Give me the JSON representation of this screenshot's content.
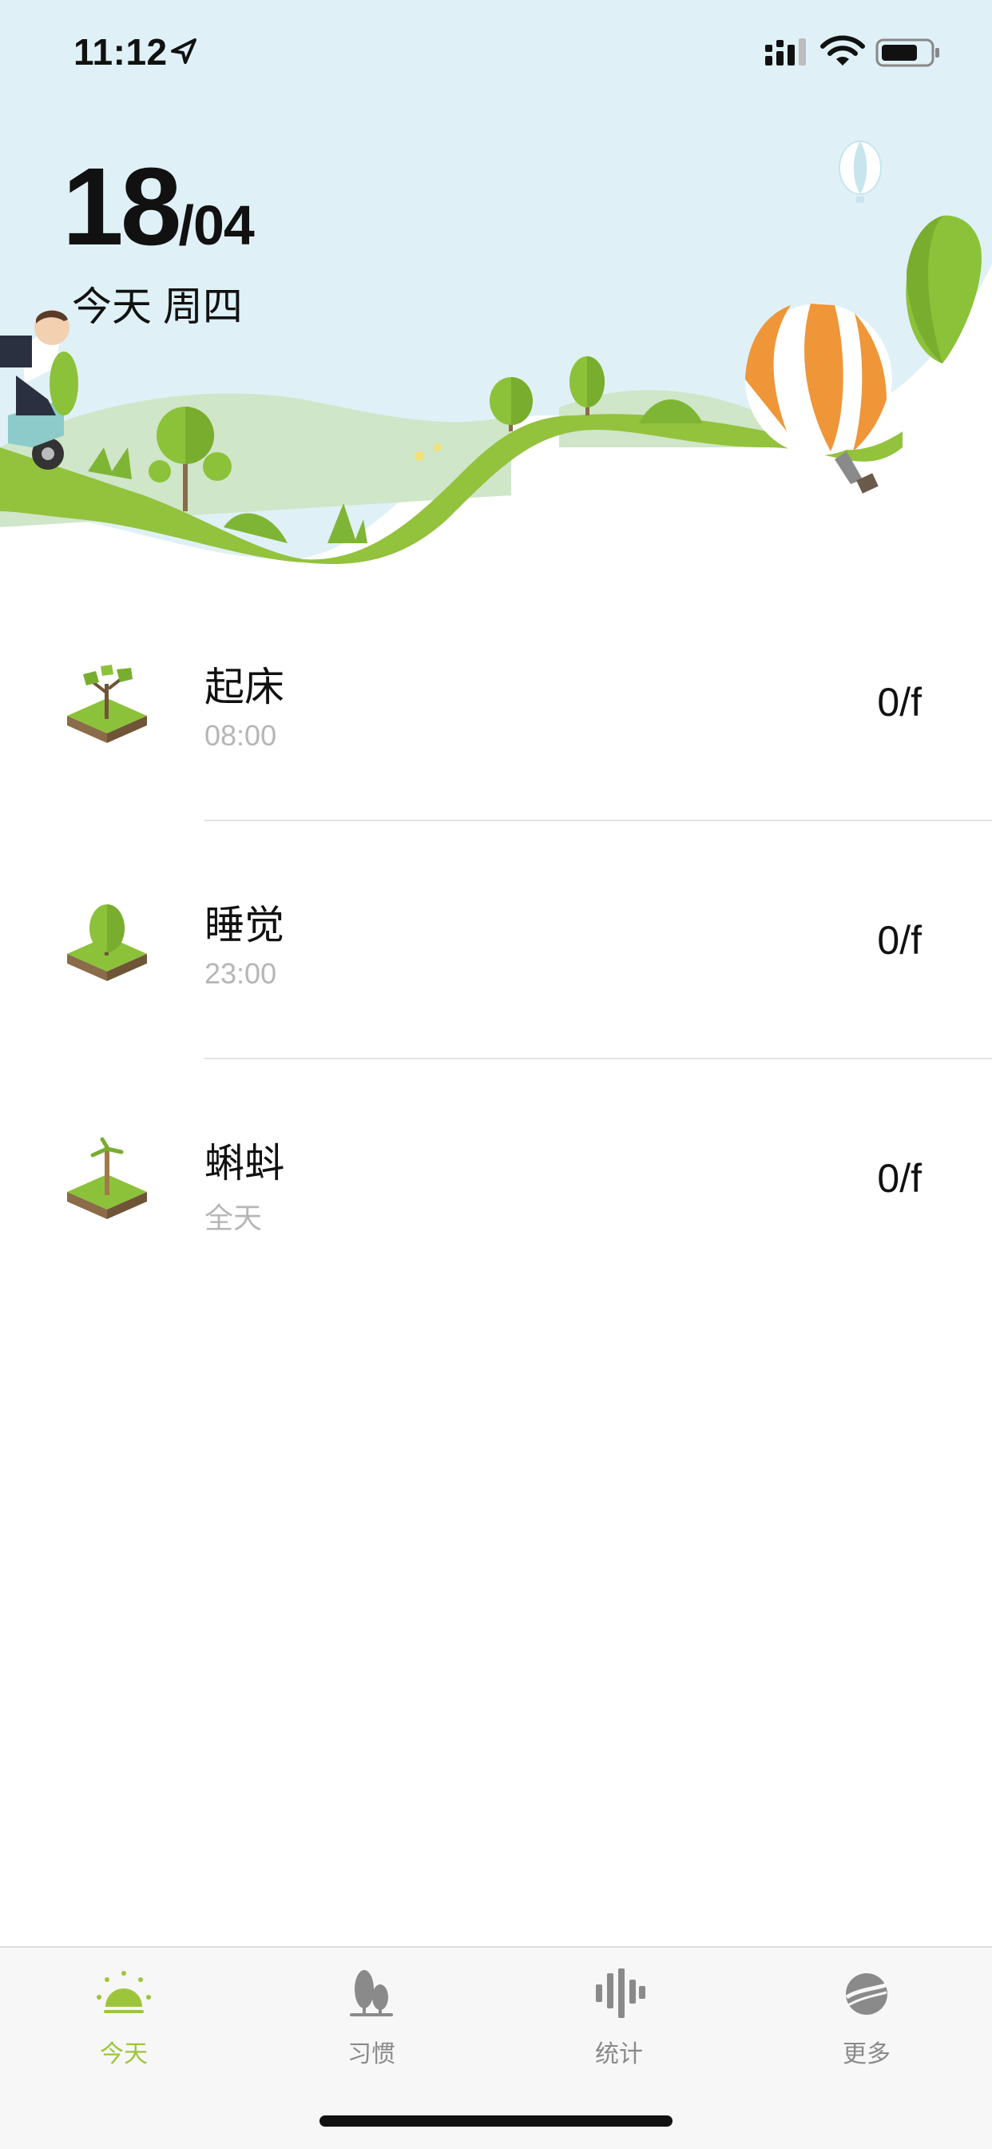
{
  "status_bar": {
    "time": "11:12",
    "icons": [
      "location-arrow-icon",
      "cellular-signal-icon",
      "wifi-icon",
      "battery-icon"
    ]
  },
  "header": {
    "day": "18",
    "month": "/04",
    "subtitle": "今天 周四"
  },
  "habits": [
    {
      "name": "起床",
      "time": "08:00",
      "count": "0/f",
      "icon": "sapling-icon"
    },
    {
      "name": "睡觉",
      "time": "23:00",
      "count": "0/f",
      "icon": "tree-icon"
    },
    {
      "name": "蝌蚪",
      "time": "全天",
      "count": "0/f",
      "icon": "palm-icon"
    }
  ],
  "tabbar": {
    "tabs": [
      {
        "label": "今天",
        "icon": "sunrise-icon",
        "active": true
      },
      {
        "label": "习惯",
        "icon": "trees-icon",
        "active": false
      },
      {
        "label": "统计",
        "icon": "bars-icon",
        "active": false
      },
      {
        "label": "更多",
        "icon": "globe-icon",
        "active": false
      }
    ]
  },
  "colors": {
    "accent": "#9dc53c",
    "sky": "#dff1f6",
    "grass": "#93c23c",
    "balloon_orange": "#ef9638",
    "inactive_tab": "#8a8a8a"
  }
}
